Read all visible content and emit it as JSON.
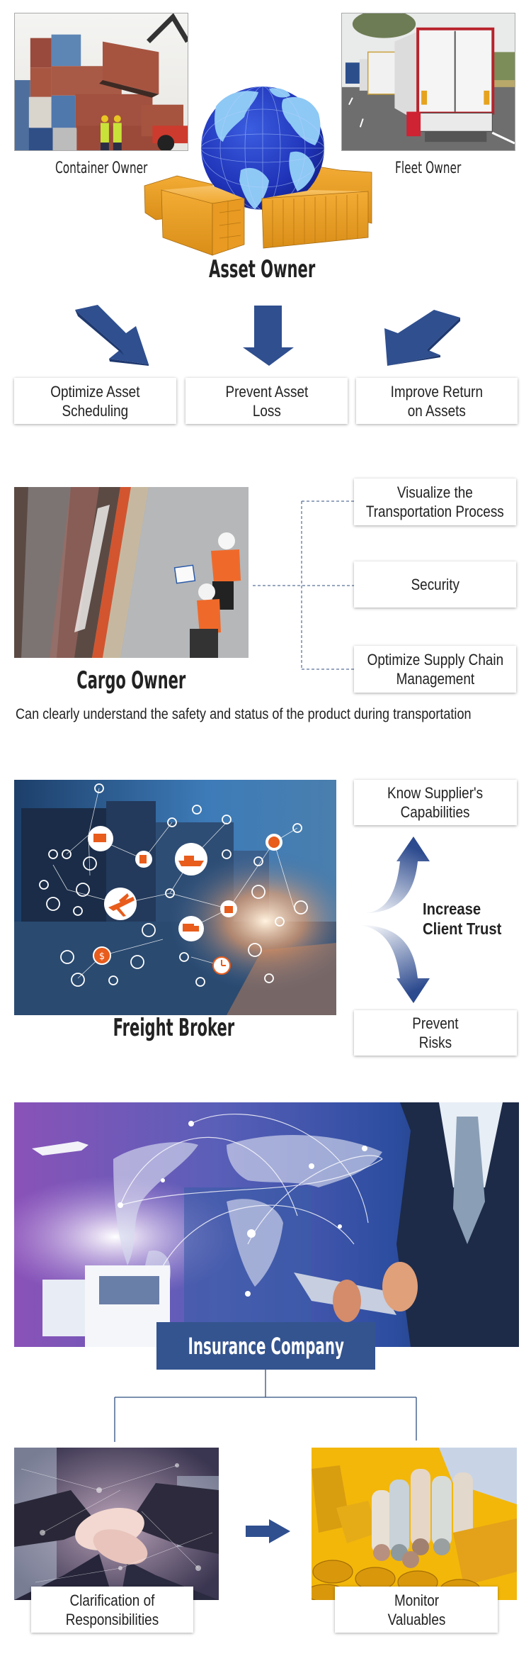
{
  "colors": {
    "accent_blue": "#2f4f8f",
    "label_bg": "#34548f",
    "text": "#222222",
    "connector": "#2f4f7f"
  },
  "asset_owner": {
    "title": "Asset Owner",
    "container_owner_label": "Container Owner",
    "fleet_owner_label": "Fleet Owner",
    "benefits": [
      {
        "line1": "Optimize Asset",
        "line2": "Scheduling"
      },
      {
        "line1": "Prevent Asset",
        "line2": "Loss"
      },
      {
        "line1": "Improve Return",
        "line2": "on Assets"
      }
    ]
  },
  "cargo_owner": {
    "title": "Cargo Owner",
    "benefits": [
      {
        "line1": "Visualize the",
        "line2": "Transportation Process"
      },
      {
        "line1": "Security",
        "line2": ""
      },
      {
        "line1": "Optimize Supply Chain",
        "line2": "Management"
      }
    ],
    "caption": "Can clearly understand the safety and status of the product during transportation"
  },
  "freight_broker": {
    "title": "Freight Broker",
    "center_label_line1": "Increase",
    "center_label_line2": "Client Trust",
    "benefits": [
      {
        "line1": "Know Supplier's",
        "line2": "Capabilities"
      },
      {
        "line1": "Prevent",
        "line2": "Risks"
      }
    ]
  },
  "insurance_company": {
    "title": "Insurance Company",
    "benefits": [
      {
        "line1": "Clarification of",
        "line2": "Responsibilities"
      },
      {
        "line1": "Monitor",
        "line2": "Valuables"
      }
    ]
  },
  "icons": {
    "network_nodes": [
      "forklift-icon",
      "document-icon",
      "ship-icon",
      "globe-icon",
      "airplane-icon",
      "package-icon",
      "truck-icon",
      "dollar-icon",
      "clock-icon"
    ]
  }
}
